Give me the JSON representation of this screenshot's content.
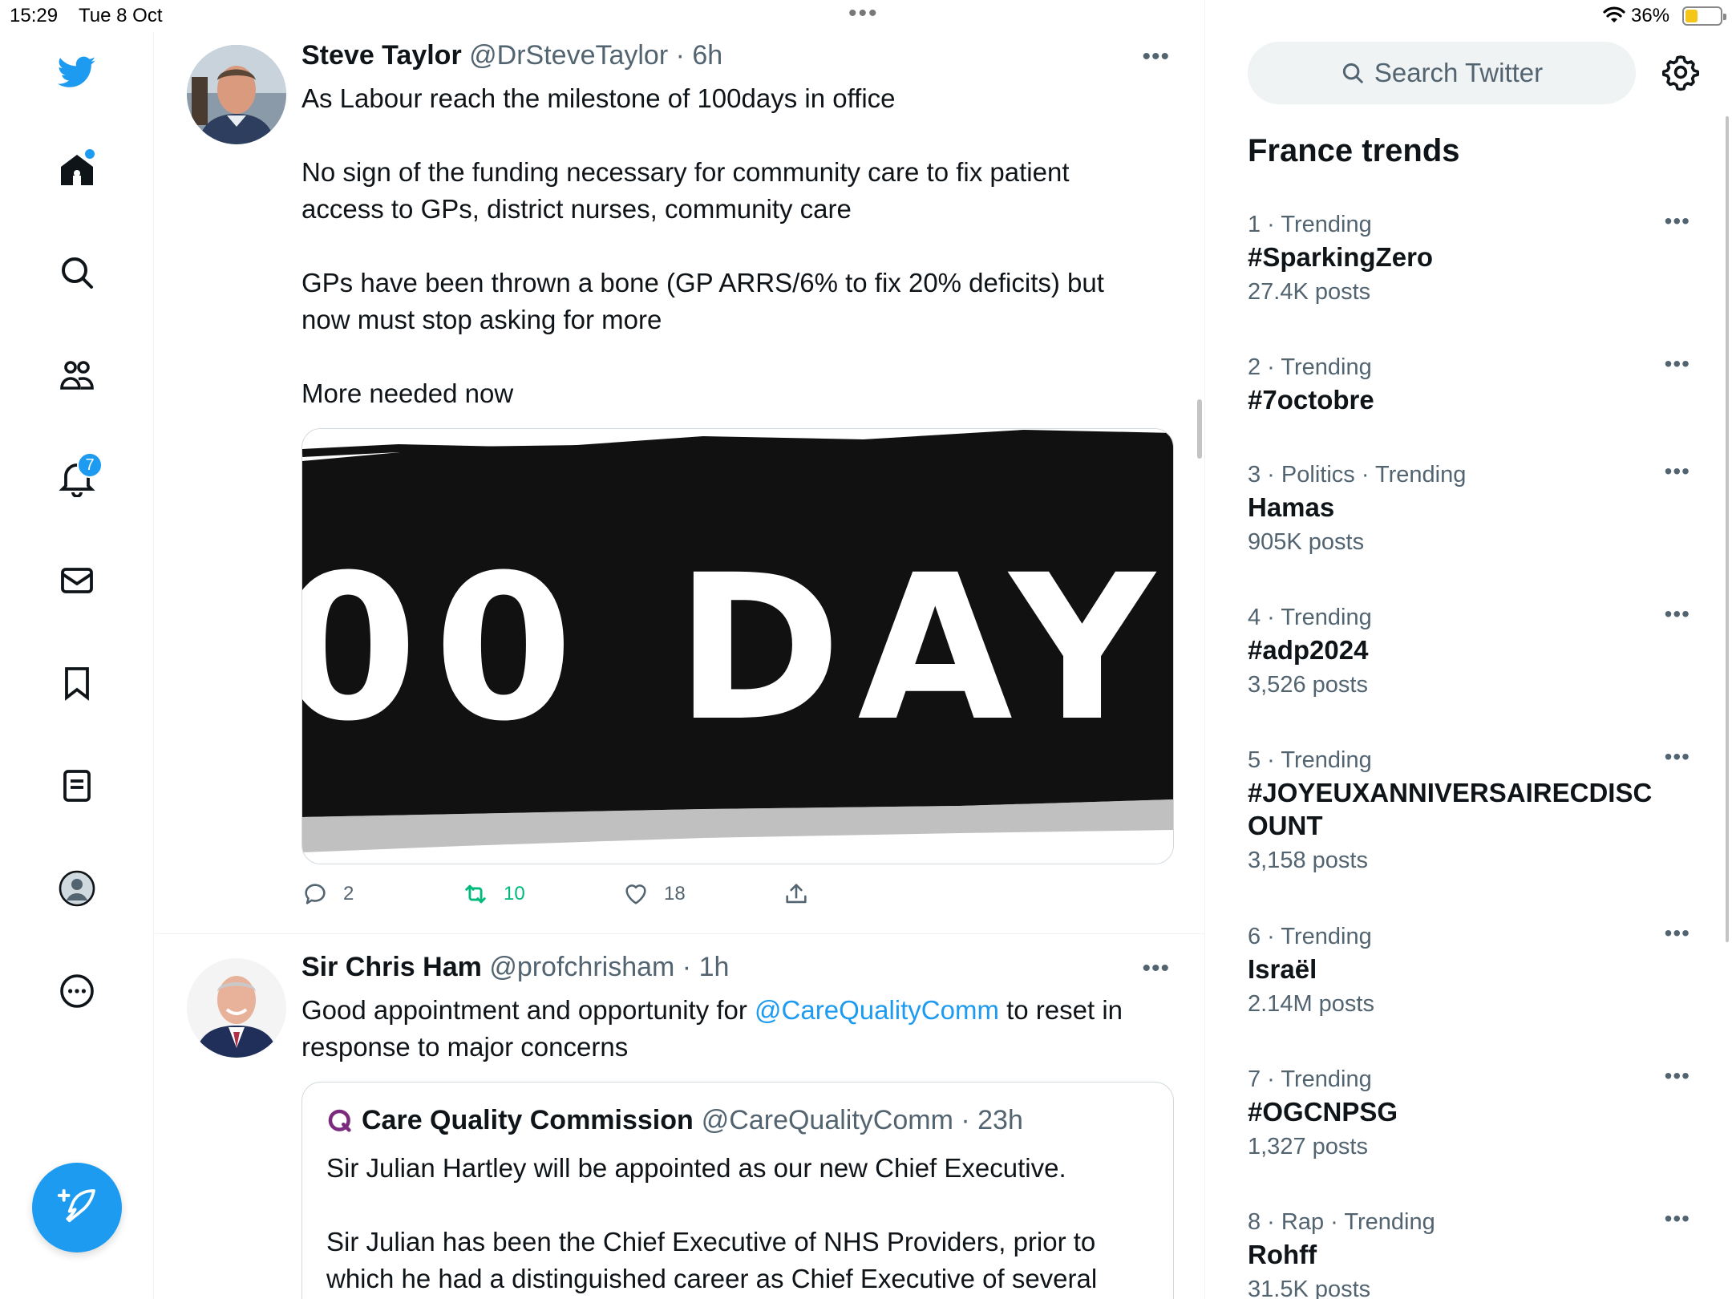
{
  "status_bar": {
    "time": "15:29",
    "date": "Tue 8 Oct",
    "battery_percent": "36%",
    "battery_level": 0.36
  },
  "nav": {
    "notifications_badge": "7"
  },
  "tweets": [
    {
      "name": "Steve Taylor",
      "handle": "@DrSteveTaylor",
      "time": "6h",
      "body": [
        "As Labour reach the milestone of 100days in office",
        "",
        "No sign of the funding necessary for community care to fix patient access to GPs, district nurses, community care",
        "",
        "GPs have been thrown a bone (GP ARRS/6% to fix 20% deficits) but now must stop asking for more",
        "",
        "More needed now"
      ],
      "media_text": "00 DAY",
      "replies": "2",
      "retweets": "10",
      "likes": "18"
    },
    {
      "name": "Sir Chris Ham",
      "handle": "@profchrisham",
      "time": "1h",
      "body_before": "Good appointment and opportunity for ",
      "mention": "@CareQualityComm",
      "body_after": " to reset in response to major concerns",
      "quote": {
        "name": "Care Quality Commission",
        "handle": "@CareQualityComm",
        "time": "23h",
        "body": [
          "Sir Julian Hartley will be appointed as our new Chief Executive.",
          "",
          "Sir Julian has been the Chief Executive of NHS Providers, prior to which he had a distinguished career as Chief Executive of several"
        ]
      }
    }
  ],
  "sidebar": {
    "search_placeholder": "Search Twitter",
    "trends_title": "France trends",
    "trends": [
      {
        "meta": "1 · Trending",
        "topic": "#SparkingZero",
        "posts": "27.4K posts"
      },
      {
        "meta": "2 · Trending",
        "topic": "#7octobre",
        "posts": ""
      },
      {
        "meta": "3 · Politics · Trending",
        "topic": "Hamas",
        "posts": "905K posts"
      },
      {
        "meta": "4 · Trending",
        "topic": "#adp2024",
        "posts": "3,526 posts"
      },
      {
        "meta": "5 · Trending",
        "topic": "#JOYEUXANNIVERSAIRECDISCOUNT",
        "posts": "3,158 posts"
      },
      {
        "meta": "6 · Trending",
        "topic": "Israël",
        "posts": "2.14M posts"
      },
      {
        "meta": "7 · Trending",
        "topic": "#OGCNPSG",
        "posts": "1,327 posts"
      },
      {
        "meta": "8 · Rap · Trending",
        "topic": "Rohff",
        "posts": "31.5K posts"
      }
    ]
  },
  "colors": {
    "accent": "#1d9bf0",
    "retweet": "#00ba7c",
    "secondary_text": "#536471",
    "cqc_logo": "#7b2a7e"
  },
  "icons": [
    "twitter-bird-icon",
    "home-icon",
    "search-icon",
    "communities-icon",
    "bell-icon",
    "mail-icon",
    "bookmark-icon",
    "lists-icon",
    "profile-icon",
    "more-circle-icon",
    "compose-feather-icon",
    "reply-icon",
    "retweet-icon",
    "heart-icon",
    "share-icon",
    "gear-icon",
    "wifi-icon",
    "battery-icon"
  ]
}
